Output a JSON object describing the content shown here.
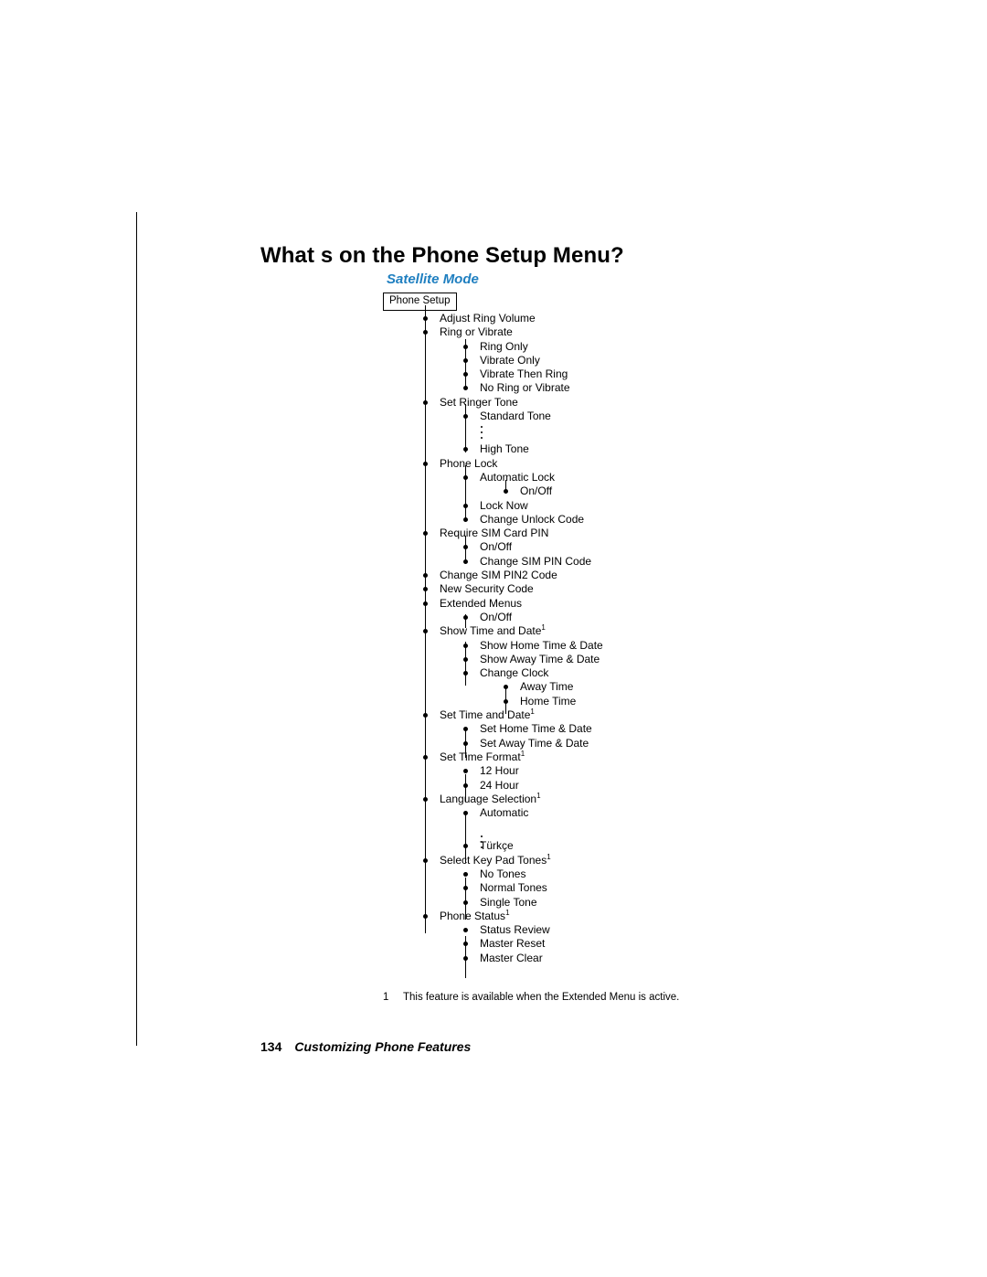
{
  "document": {
    "title": "What s on the Phone Setup Menu?",
    "section": "Satellite Mode",
    "root_box": "Phone Setup",
    "footnote": {
      "marker": "1",
      "text": "This feature is available when the Extended Menu is active."
    },
    "footer": {
      "page_number": "134",
      "text": "Customizing Phone Features"
    },
    "accent_color": "#1f7fc0"
  },
  "tree": [
    {
      "level": 1,
      "label": "Adjust Ring Volume"
    },
    {
      "level": 1,
      "label": "Ring or Vibrate"
    },
    {
      "level": 2,
      "label": "Ring Only"
    },
    {
      "level": 2,
      "label": "Vibrate Only"
    },
    {
      "level": 2,
      "label": "Vibrate Then Ring"
    },
    {
      "level": 2,
      "label": "No Ring or Vibrate"
    },
    {
      "level": 1,
      "label": "Set Ringer Tone"
    },
    {
      "level": 2,
      "label": "Standard Tone"
    },
    {
      "level": 2,
      "label": "High Tone"
    },
    {
      "level": 1,
      "label": "Phone Lock"
    },
    {
      "level": 2,
      "label": "Automatic Lock"
    },
    {
      "level": 3,
      "label": "On/Off"
    },
    {
      "level": 2,
      "label": "Lock Now"
    },
    {
      "level": 2,
      "label": "Change Unlock Code"
    },
    {
      "level": 1,
      "label": "Require SIM Card PIN"
    },
    {
      "level": 2,
      "label": "On/Off"
    },
    {
      "level": 2,
      "label": "Change SIM PIN Code"
    },
    {
      "level": 1,
      "label": "Change SIM PIN2 Code"
    },
    {
      "level": 1,
      "label": "New Security Code"
    },
    {
      "level": 1,
      "label": "Extended Menus"
    },
    {
      "level": 2,
      "label": "On/Off"
    },
    {
      "level": 1,
      "label": "Show Time and Date",
      "footnote": "1"
    },
    {
      "level": 2,
      "label": "Show Home Time & Date"
    },
    {
      "level": 2,
      "label": "Show Away Time & Date"
    },
    {
      "level": 2,
      "label": "Change Clock"
    },
    {
      "level": 3,
      "label": "Away Time"
    },
    {
      "level": 3,
      "label": "Home Time"
    },
    {
      "level": 1,
      "label": "Set Time and Date",
      "footnote": "1"
    },
    {
      "level": 2,
      "label": "Set Home Time & Date"
    },
    {
      "level": 2,
      "label": "Set Away Time & Date"
    },
    {
      "level": 1,
      "label": "Set Time Format",
      "footnote": "1"
    },
    {
      "level": 2,
      "label": "12 Hour"
    },
    {
      "level": 2,
      "label": "24 Hour"
    },
    {
      "level": 1,
      "label": "Language Selection",
      "footnote": "1"
    },
    {
      "level": 2,
      "label": "Automatic"
    },
    {
      "level": 2,
      "label": "Türkçe"
    },
    {
      "level": 1,
      "label": "Select Key Pad Tones",
      "footnote": "1"
    },
    {
      "level": 2,
      "label": "No Tones"
    },
    {
      "level": 2,
      "label": "Normal Tones"
    },
    {
      "level": 2,
      "label": "Single Tone"
    },
    {
      "level": 1,
      "label": "Phone Status",
      "footnote": "1"
    },
    {
      "level": 2,
      "label": "Status Review"
    },
    {
      "level": 2,
      "label": "Master Reset"
    },
    {
      "level": 2,
      "label": "Master Clear"
    }
  ]
}
